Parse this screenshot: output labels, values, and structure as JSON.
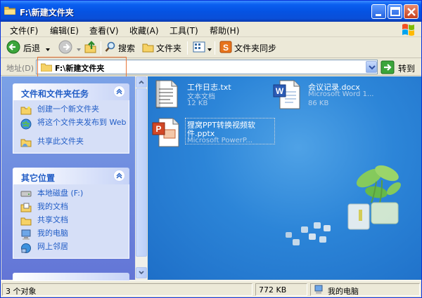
{
  "window": {
    "title": "F:\\新建文件夹"
  },
  "menu": [
    "文件(F)",
    "编辑(E)",
    "查看(V)",
    "收藏(A)",
    "工具(T)",
    "帮助(H)"
  ],
  "toolbar": {
    "back": "后退",
    "search": "搜索",
    "folders": "文件夹",
    "sync": "文件夹同步"
  },
  "address": {
    "label": "地址(D)",
    "value": "F:\\新建文件夹",
    "go": "转到"
  },
  "tasks_panel": {
    "title": "文件和文件夹任务",
    "items": [
      "创建一个新文件夹",
      "将这个文件夹发布到 Web",
      "共享此文件夹"
    ]
  },
  "places_panel": {
    "title": "其它位置",
    "items": [
      "本地磁盘 (F:)",
      "我的文档",
      "共享文档",
      "我的电脑",
      "网上邻居"
    ]
  },
  "files": [
    {
      "name": "工作日志.txt",
      "type": "文本文档",
      "size": "12 KB",
      "icon": "text-file-icon"
    },
    {
      "name": "会议记录.docx",
      "type": "Microsoft Word 1...",
      "size": "86 KB",
      "icon": "word-file-icon"
    },
    {
      "name": "狸窝PPT转换视频软件.pptx",
      "type": "Microsoft PowerP...",
      "icon": "powerpoint-file-icon"
    }
  ],
  "status": {
    "objects": "3 个对象",
    "size": "772 KB",
    "location": "我的电脑"
  }
}
